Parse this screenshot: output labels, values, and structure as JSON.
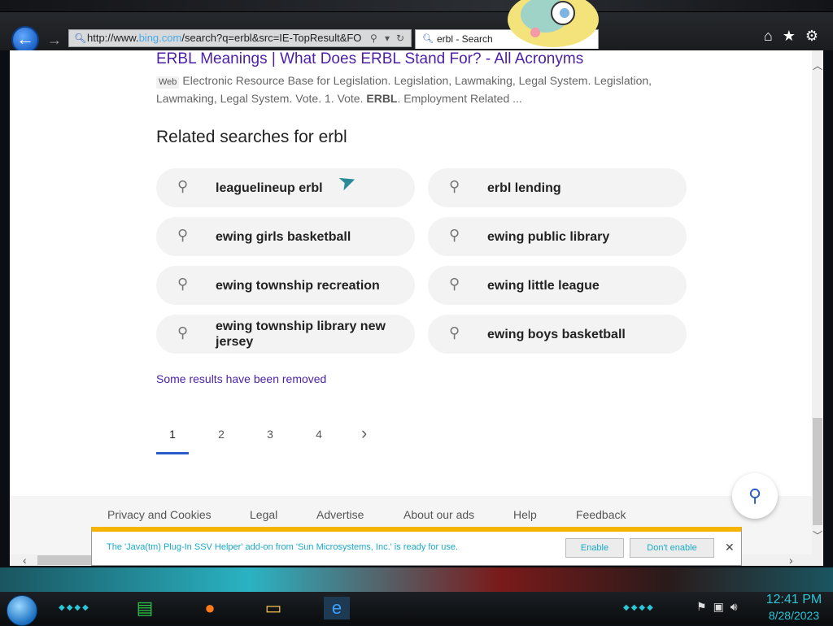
{
  "browser": {
    "address": {
      "url_prefix": "http://www.",
      "url_domain": "bing.com",
      "url_rest": "/search?q=erbl&src=IE-TopResult&FO"
    },
    "tab": {
      "label": "erbl - Search"
    }
  },
  "result": {
    "title": "ERBL Meanings | What Does ERBL Stand For? - All Acronyms",
    "badge": "Web",
    "snippet_start": "Electronic Resource Base for Legislation. Legislation, Lawmaking, Legal System. Legislation, Lawmaking, Legal System. Vote. 1. Vote. ",
    "snippet_bold": "ERBL",
    "snippet_end": ". Employment Related ..."
  },
  "related": {
    "heading": "Related searches for erbl",
    "items": [
      "leaguelineup erbl",
      "erbl lending",
      "ewing girls basketball",
      "ewing public library",
      "ewing township recreation",
      "ewing little league",
      "ewing township library new jersey",
      "ewing boys basketball"
    ]
  },
  "removed_note": "Some results have been removed",
  "pagination": {
    "pages": [
      "1",
      "2",
      "3",
      "4"
    ],
    "current": "1"
  },
  "footer": {
    "links": [
      "Privacy and Cookies",
      "Legal",
      "Advertise",
      "About our ads",
      "Help",
      "Feedback"
    ]
  },
  "notification": {
    "message": "The 'Java(tm) Plug-In SSV Helper' add-on from 'Sun Microsystems, Inc.' is ready for use.",
    "enable_label": "Enable",
    "dont_enable_label": "Don't enable"
  },
  "taskbar": {
    "time": "12:41 PM",
    "date": "8/28/2023"
  },
  "colors": {
    "link_purple": "#4b1fa6",
    "accent_blue": "#2b5cc7",
    "notify_bar": "#f5b400",
    "notify_text": "#1aa9c9"
  }
}
